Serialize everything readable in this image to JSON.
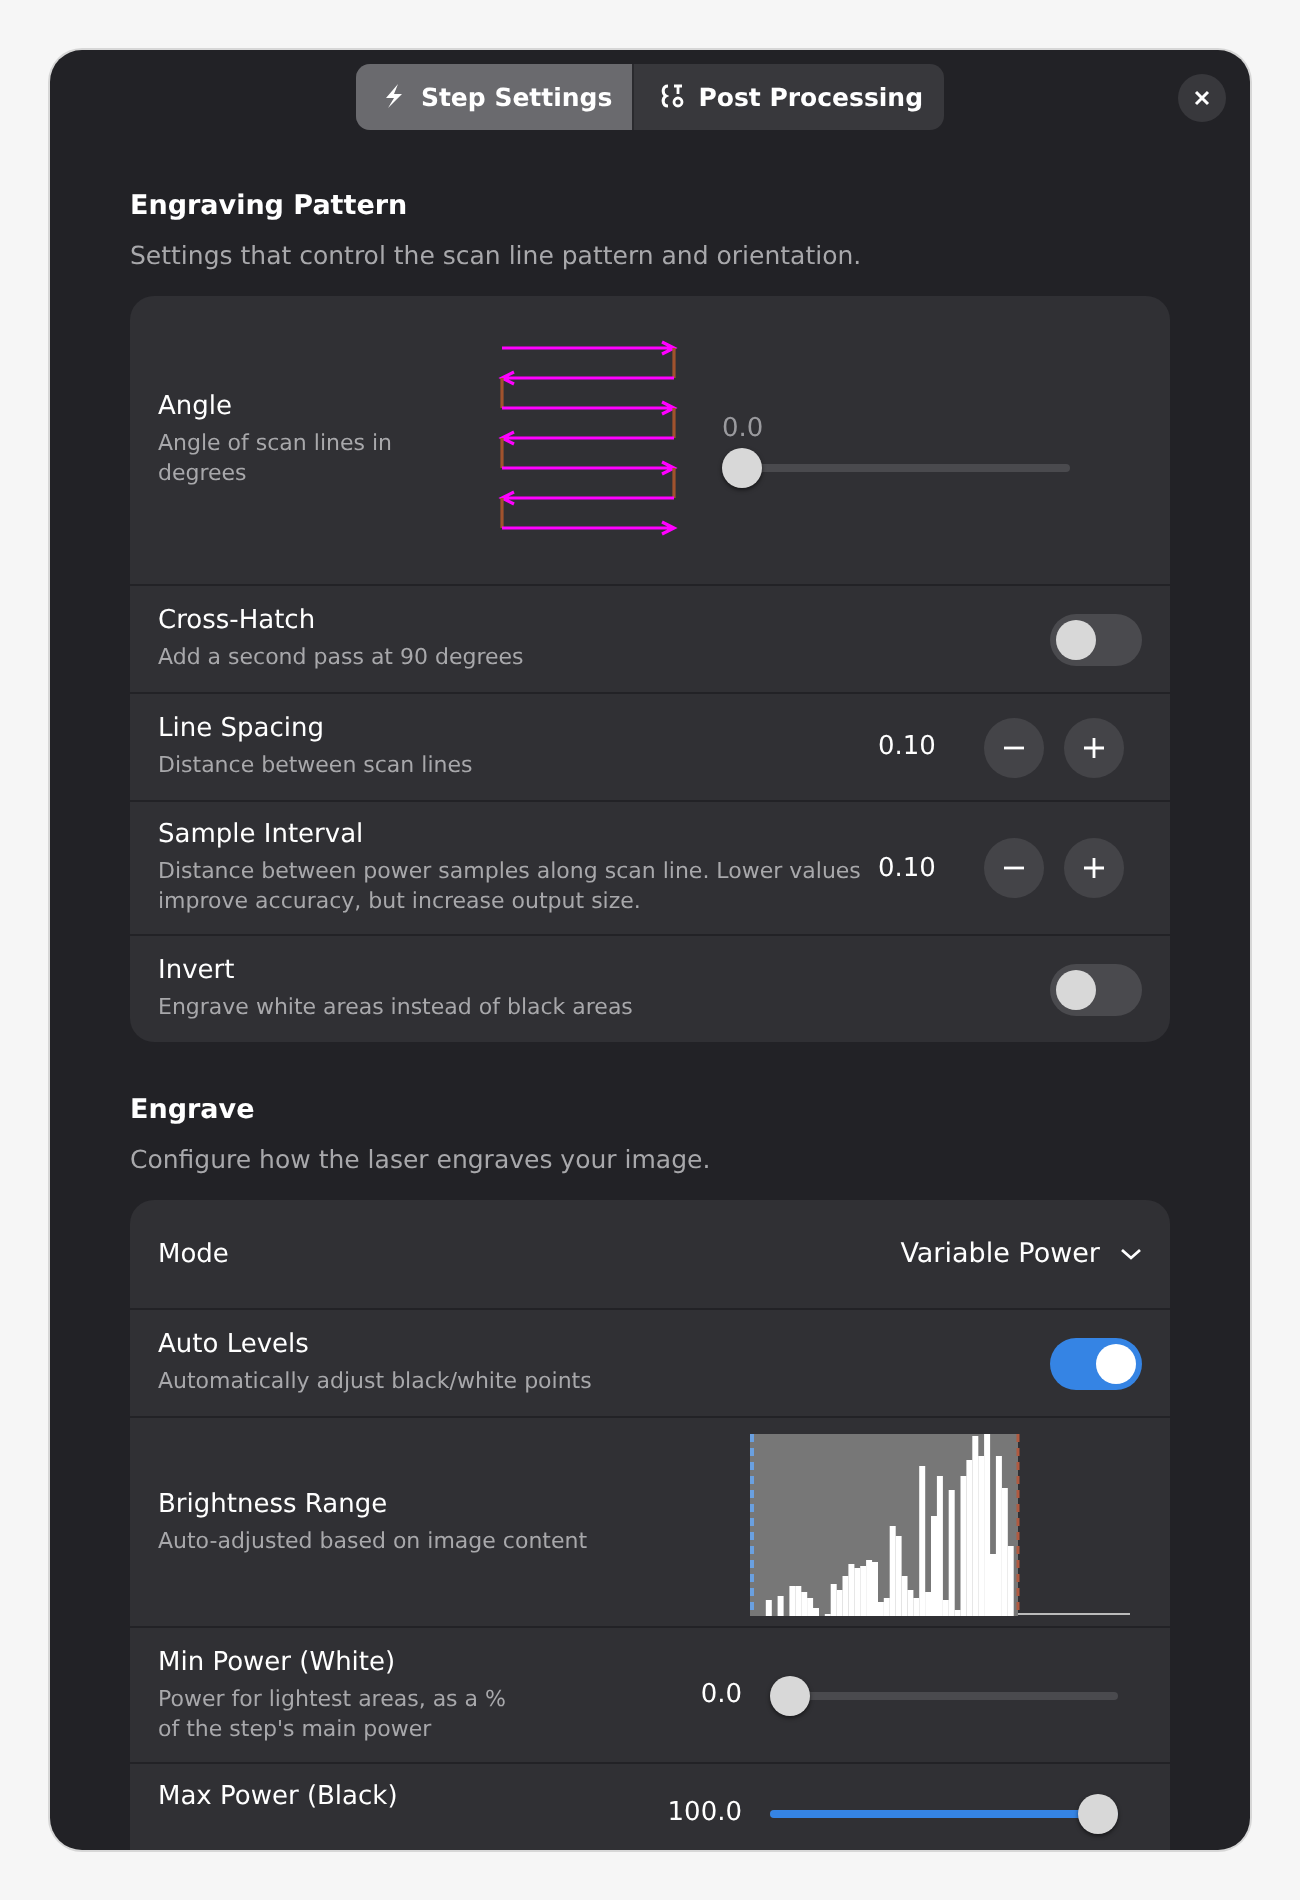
{
  "tabs": [
    {
      "label": "Step Settings",
      "selected": true
    },
    {
      "label": "Post Processing",
      "selected": false
    }
  ],
  "sections": [
    {
      "title": "Engraving Pattern",
      "subtitle": "Settings that control the scan line pattern and orientation.",
      "rows": [
        {
          "kind": "angle",
          "title": "Angle",
          "subtitle": "Angle of scan lines in degrees",
          "reading": "0.0",
          "level": 0
        },
        {
          "kind": "switch",
          "title": "Cross-Hatch",
          "subtitle": "Add a second pass at 90 degrees",
          "on": false
        },
        {
          "kind": "spin",
          "title": "Line Spacing",
          "subtitle": "Distance between scan lines",
          "value": "0.10"
        },
        {
          "kind": "spin",
          "title": "Sample Interval",
          "subtitle": "Distance between power samples along scan line. Lower values improve accuracy, but increase output size.",
          "value": "0.10"
        },
        {
          "kind": "switch",
          "title": "Invert",
          "subtitle": "Engrave white areas instead of black areas",
          "on": false
        }
      ]
    },
    {
      "title": "Engrave",
      "subtitle": "Configure how the laser engraves your image.",
      "rows": [
        {
          "kind": "dropdown",
          "title": "Mode",
          "value": "Variable Power"
        },
        {
          "kind": "switch",
          "title": "Auto Levels",
          "subtitle": "Automatically adjust black/white points",
          "on": true
        },
        {
          "kind": "histogram",
          "title": "Brightness Range",
          "subtitle": "Auto-adjusted based on image content"
        },
        {
          "kind": "slider",
          "title": "Min Power (White)",
          "subtitle": "Power for lightest areas, as a % of the step's main power",
          "reading": "0.0",
          "level": 0
        },
        {
          "kind": "slider",
          "title": "Max Power (Black)",
          "reading": "100.0",
          "level": 1
        }
      ]
    }
  ]
}
